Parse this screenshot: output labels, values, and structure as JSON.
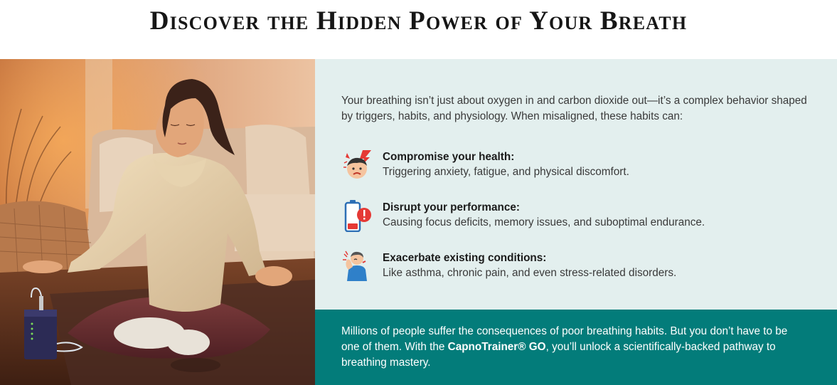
{
  "header": {
    "title": "Discover the Hidden Power of Your Breath"
  },
  "intro": "Your breathing isn’t just about oxygen in and carbon dioxide out—it’s a complex behavior shaped by triggers, habits, and physiology. When misaligned, these habits can:",
  "items": [
    {
      "icon": "stressed-face-icon",
      "title": "Compromise your health:",
      "description": "Triggering anxiety, fatigue, and physical discomfort."
    },
    {
      "icon": "low-battery-alert-icon",
      "title": "Disrupt your performance:",
      "description": "Causing focus deficits, memory issues, and suboptimal endurance."
    },
    {
      "icon": "neck-pain-person-icon",
      "title": "Exacerbate existing conditions:",
      "description": "Like asthma, chronic pain, and even stress-related disorders."
    }
  ],
  "cta": {
    "text_before": "Millions of people suffer the consequences of poor breathing habits. But you don’t have to be one of them. With the ",
    "product": "CapnoTrainer® GO",
    "text_after": ", you’ll unlock a scientifically-backed pathway to breathing mastery."
  },
  "colors": {
    "info_background": "#e3efee",
    "cta_background": "#037c7a",
    "title_color": "#161616"
  }
}
